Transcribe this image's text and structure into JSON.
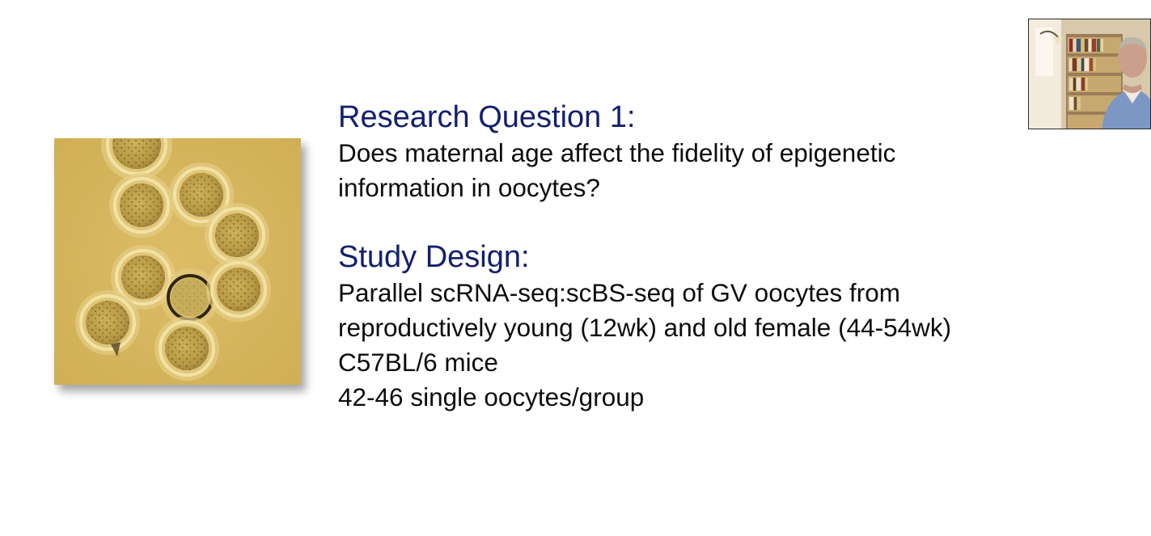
{
  "slide": {
    "question_heading": "Research Question 1:",
    "question_lines": [
      "Does maternal age affect the fidelity of epigenetic",
      "information in oocytes?"
    ],
    "design_heading": "Study Design:",
    "design_lines": [
      "Parallel scRNA-seq:scBS-seq of GV oocytes from",
      "reproductively young (12wk) and old female (44-54wk)",
      "C57BL/6 mice",
      "42-46 single oocytes/group"
    ]
  },
  "colors": {
    "heading": "#13206e",
    "body_text": "#0d0d0d",
    "background": "#ffffff",
    "micrograph_bg": "#d7b65e"
  },
  "icons": {
    "micrograph": "oocyte-micrograph",
    "presenter": "presenter-video"
  }
}
